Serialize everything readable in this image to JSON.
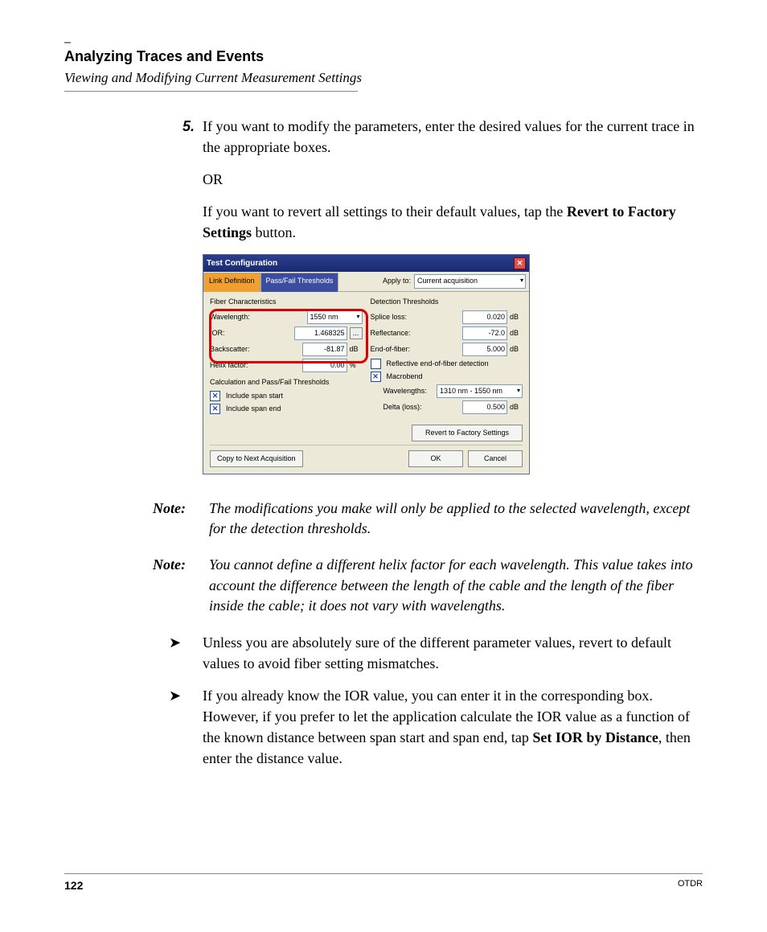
{
  "header": {
    "title": "Analyzing Traces and Events",
    "subtitle": "Viewing and Modifying Current Measurement Settings"
  },
  "step": {
    "num": "5.",
    "text": "If you want to modify the parameters, enter the desired values for the current trace in the appropriate boxes.",
    "or": "OR",
    "text2_a": "If you want to revert all settings to their default values, tap the ",
    "text2_b": "Revert to Factory Settings",
    "text2_c": " button."
  },
  "dialog": {
    "title": "Test Configuration",
    "tabs": {
      "link": "Link Definition",
      "pf": "Pass/Fail Thresholds"
    },
    "apply_label": "Apply to:",
    "apply_value": "Current acquisition",
    "fiber": {
      "title": "Fiber Characteristics",
      "wavelength_l": "Wavelength:",
      "wavelength_v": "1550 nm",
      "ior_l": "IOR:",
      "ior_v": "1.468325",
      "back_l": "Backscatter:",
      "back_v": "-81.87",
      "back_u": "dB",
      "helix_l": "Helix factor:",
      "helix_v": "0.00",
      "helix_u": "%"
    },
    "calc": {
      "title": "Calculation and Pass/Fail Thresholds",
      "span_start": "Include span start",
      "span_end": "Include span end"
    },
    "det": {
      "title": "Detection Thresholds",
      "splice_l": "Splice loss:",
      "splice_v": "0.020",
      "refl_l": "Reflectance:",
      "refl_v": "-72.0",
      "eof_l": "End-of-fiber:",
      "eof_v": "5.000",
      "unit": "dB",
      "reof": "Reflective end-of-fiber detection",
      "macro": "Macrobend",
      "wl_l": "Wavelengths:",
      "wl_v": "1310 nm - 1550 nm",
      "delta_l": "Delta (loss):",
      "delta_v": "0.500"
    },
    "buttons": {
      "revert": "Revert to Factory Settings",
      "copy": "Copy to Next Acquisition",
      "ok": "OK",
      "cancel": "Cancel"
    },
    "dots": "..."
  },
  "notes": {
    "label": "Note:",
    "n1": "The modifications you make will only be applied to the selected wavelength, except for the detection thresholds.",
    "n2": "You cannot define a different helix factor for each wavelength. This value takes into account the difference between the length of the cable and the length of the fiber inside the cable; it does not vary with wavelengths."
  },
  "bullets": {
    "arrow": "➤",
    "b1": "Unless you are absolutely sure of the different parameter values, revert to default values to avoid fiber setting mismatches.",
    "b2_a": "If you already know the IOR value, you can enter it in the corresponding box. However, if you prefer to let the application calculate the IOR value as a function of the known distance between span start and span end, tap ",
    "b2_b": "Set IOR by Distance",
    "b2_c": ", then enter the distance value."
  },
  "footer": {
    "page": "122",
    "doc": "OTDR"
  }
}
